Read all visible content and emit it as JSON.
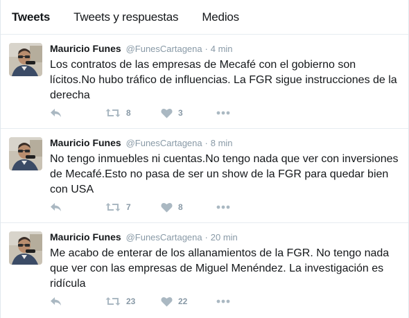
{
  "tabs": [
    {
      "label": "Tweets",
      "active": true
    },
    {
      "label": "Tweets y respuestas",
      "active": false
    },
    {
      "label": "Medios",
      "active": false
    }
  ],
  "tweets": [
    {
      "name": "Mauricio Funes",
      "handle": "@FunesCartagena",
      "separator": "·",
      "time": "4 min",
      "text": "Los contratos de las empresas de Mecafé con el gobierno son lícitos.No hubo tráfico de influencias. La FGR sigue instrucciones de la derecha",
      "retweets": "8",
      "likes": "3"
    },
    {
      "name": "Mauricio Funes",
      "handle": "@FunesCartagena",
      "separator": "·",
      "time": "8 min",
      "text": "No tengo inmuebles ni cuentas.No tengo nada que ver con inversiones de Mecafé.Esto no pasa de ser un show de la FGR para quedar bien con USA",
      "retweets": "7",
      "likes": "8"
    },
    {
      "name": "Mauricio Funes",
      "handle": "@FunesCartagena",
      "separator": "·",
      "time": "20 min",
      "text": "Me acabo de enterar de los allanamientos de la FGR. No tengo nada que ver con las empresas de Miguel Menéndez. La investigación es ridícula",
      "retweets": "23",
      "likes": "22"
    }
  ],
  "icons": {
    "reply": "reply-icon",
    "retweet": "retweet-icon",
    "like": "heart-icon",
    "more": "more-dots-icon"
  },
  "colors": {
    "text": "#14171a",
    "muted": "#8899a6",
    "icon": "#aab8c2",
    "divider": "#e6ecf0"
  }
}
